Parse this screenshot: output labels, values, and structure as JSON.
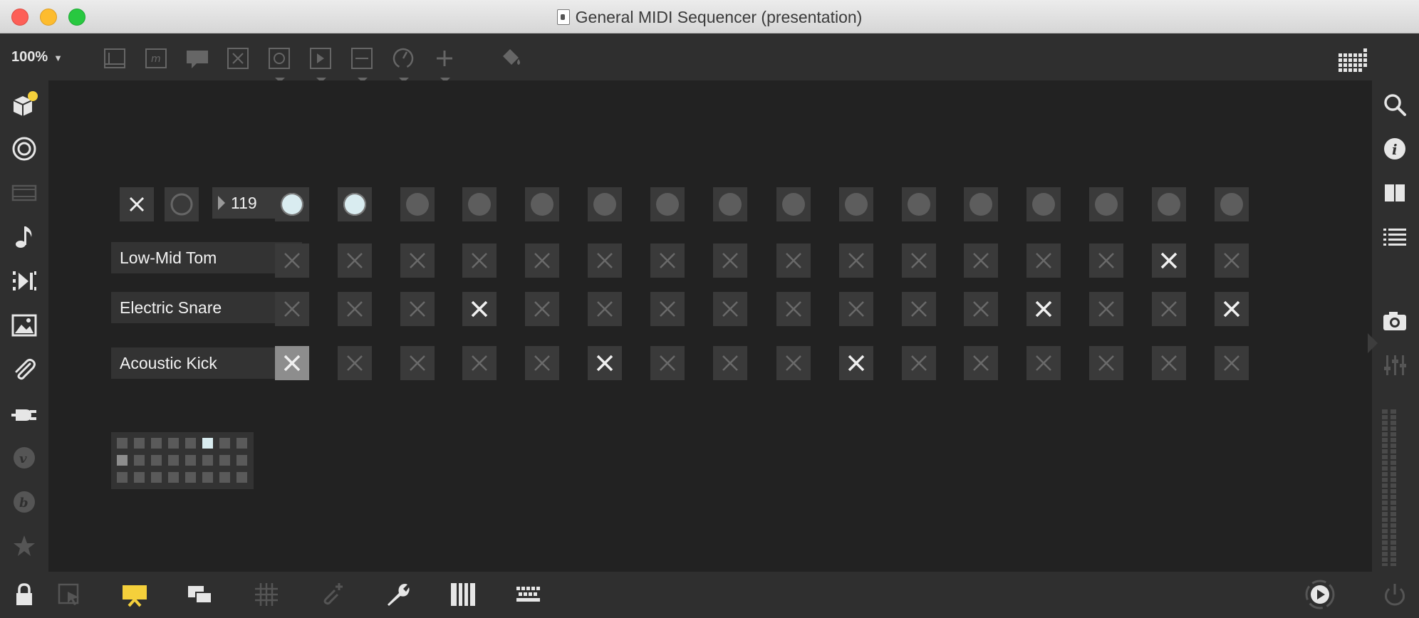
{
  "window": {
    "title": "General MIDI Sequencer (presentation)"
  },
  "toolbar": {
    "zoom": "100%",
    "zoom_caret": "▼"
  },
  "sequencer": {
    "tempo_value": "119",
    "step_leds": [
      true,
      true,
      false,
      false,
      false,
      false,
      false,
      false,
      false,
      false,
      false,
      false,
      false,
      false,
      false,
      false
    ],
    "tracks": [
      {
        "name": "Low-Mid Tom",
        "steps": [
          0,
          0,
          0,
          0,
          0,
          0,
          0,
          0,
          0,
          0,
          0,
          0,
          0,
          0,
          1,
          0
        ]
      },
      {
        "name": "Electric Snare",
        "steps": [
          0,
          0,
          0,
          1,
          0,
          0,
          0,
          0,
          0,
          0,
          0,
          0,
          1,
          0,
          0,
          1
        ]
      },
      {
        "name": "Acoustic Kick",
        "steps": [
          1,
          0,
          0,
          0,
          0,
          1,
          0,
          0,
          0,
          1,
          0,
          0,
          0,
          0,
          0,
          0
        ],
        "focused_step": 0
      }
    ],
    "pattern_matrix": {
      "columns": 8,
      "rows": 3,
      "lit": [
        [
          0,
          5
        ]
      ],
      "mid": [
        [
          1,
          0
        ]
      ]
    }
  },
  "colors": {
    "accent_yellow": "#f5d03b",
    "led_on": "#d9ecf0",
    "background": "#222222",
    "panel": "#2f2f2f"
  },
  "icons": {
    "left": [
      "package-icon",
      "target-icon",
      "film-icon",
      "music-note-icon",
      "step-forward-icon",
      "image-icon",
      "paperclip-icon",
      "plug-icon",
      "vimeo-icon",
      "bandcamp-icon",
      "star-icon"
    ],
    "right": [
      "search-icon",
      "info-icon",
      "columns-icon",
      "list-icon",
      "camera-icon",
      "sliders-icon"
    ],
    "bottom": [
      "lock-icon",
      "select-icon",
      "presentation-icon",
      "windows-icon",
      "grid-icon",
      "clip-add-icon",
      "wrench-icon",
      "piano-icon",
      "keyboard-icon",
      "play-dial-icon",
      "power-icon"
    ]
  }
}
